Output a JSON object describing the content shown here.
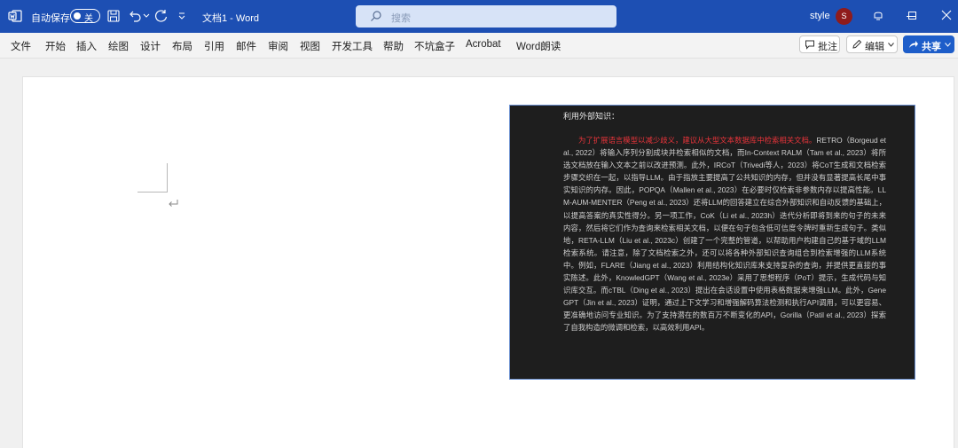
{
  "titlebar": {
    "autosave_label": "自动保存",
    "autosave_state": "关",
    "doc_title": "文档1  -  Word",
    "search_placeholder": "搜索",
    "user_name": "style",
    "avatar_initial": "S",
    "bg_color": "#1d4fb3"
  },
  "menu": {
    "tabs": [
      "文件",
      "开始",
      "插入",
      "绘图",
      "设计",
      "布局",
      "引用",
      "邮件",
      "审阅",
      "视图",
      "开发工具",
      "帮助",
      "不坑盒子",
      "Acrobat",
      "Word朗读"
    ],
    "comment_label": "批注",
    "edit_label": "编辑",
    "share_label": "共享"
  },
  "document": {
    "image": {
      "heading": "利用外部知识：",
      "highlight": "为了扩展语言模型以减少歧义，建议从大型文本数据库中检索相关文档。",
      "body": "RETRO（Borgeud et al., 2022）将输入序列分割成块并检索相似的文档，而In-Context RALM（Tam et al., 2023）将所选文档放在输入文本之前以改进预测。此外，IRCoT（Trivedi等人，2023）将CoT生成和文档检索步骤交织在一起，以指导LLM。由于指放主要提高了公共知识的内存，但并没有显著提高长尾中事实知识的内存。因此，POPQA（Mallen et al., 2023）在必要时仅检索非参数内存以提高性能。LLM-AUM-MENTER（Peng et al., 2023）还将LLM的回答建立在综合外部知识和自动反馈的基础上，以提高答案的真实性得分。另一项工作，CoK（Li et al., 2023h）迭代分析即将到来的句子的未来内容，然后将它们作为查询来检索相关文档，以便在句子包含低可信度令牌时重新生成句子。类似地，RETA-LLM（Liu et al., 2023c）创建了一个完整的管道，以帮助用户构建自己的基于域的LLM检索系统。请注意，除了文档检索之外，还可以将各种外部知识查询组合到检索增强的LLM系统中。例如，FLARE（Jiang et al., 2023）利用结构化知识库来支持复杂的查询，并提供更直接的事实陈述。此外，KnowledGPT（Wang et al., 2023e）采用了思想程序（PoT）提示，生成代码与知识库交互。而cTBL（Ding et al., 2023）提出在会话设置中使用表格数据来增强LLM。此外，GeneGPT（Jin et al., 2023）证明，通过上下文学习和增强解码算法检测和执行API调用，可以更容易、更准确地访问专业知识。为了支持潜在的数百万不断变化的API，Gorilla（Patil et al., 2023）探索了自我构造的微调和检索，以高效利用API。",
      "highlight_color": "#e8343a",
      "bg_color": "#1e1e1e"
    }
  },
  "colors": {
    "share_button": "#1d5dc9",
    "avatar": "#8f1b1b"
  },
  "icons": [
    "word-logo-icon",
    "save-icon",
    "undo-icon",
    "redo-icon",
    "search-icon",
    "ribbon-options-icon",
    "minimize-icon",
    "maximize-icon",
    "close-icon",
    "comment-icon",
    "pencil-icon",
    "share-icon",
    "paragraph-mark-icon"
  ]
}
